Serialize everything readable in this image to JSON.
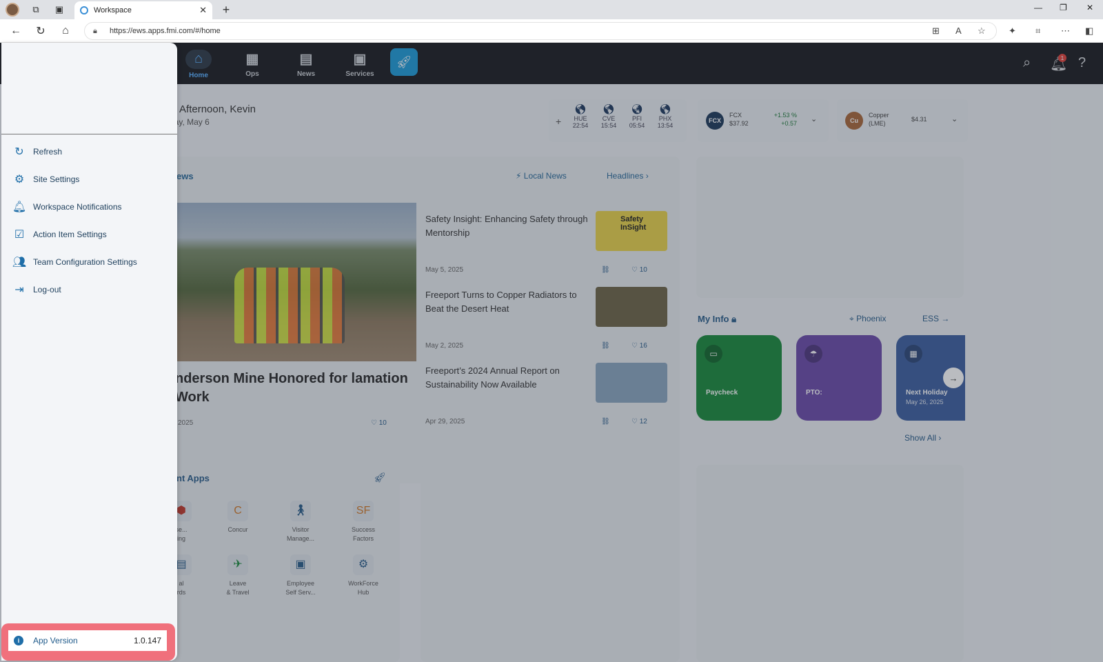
{
  "browser": {
    "tab_title": "Workspace",
    "url": "https://ews.apps.fmi.com/#/home"
  },
  "nav": {
    "items": [
      {
        "label": "Home",
        "icon": "home-icon"
      },
      {
        "label": "Ops",
        "icon": "grid-icon"
      },
      {
        "label": "News",
        "icon": "newspaper-icon"
      },
      {
        "label": "Services",
        "icon": "badge-icon"
      }
    ],
    "notification_count": "1"
  },
  "greeting": {
    "title": "od Afternoon, Kevin",
    "date": "sday, May 6"
  },
  "clocks": [
    {
      "code": "HUE",
      "time": "22:54"
    },
    {
      "code": "CVE",
      "time": "15:54"
    },
    {
      "code": "PFI",
      "time": "05:54"
    },
    {
      "code": "PHX",
      "time": "13:54"
    }
  ],
  "stock_fcx": {
    "logo": "FCX",
    "ticker": "FCX",
    "price": "$37.92",
    "pct": "+1.53 %",
    "change": "+0.57"
  },
  "stock_copper": {
    "logo": "Cu",
    "name": "Copper",
    "market": "(LME)",
    "price": "$4.31"
  },
  "news": {
    "heading": "ews",
    "local_news": "Local News",
    "headlines": "Headlines",
    "featured": {
      "title": "nderson Mine Honored for lamation Work",
      "date": "2025",
      "likes": "10"
    },
    "items": [
      {
        "title": "Safety Insight: Enhancing Safety through Mentorship",
        "date": "May 5, 2025",
        "likes": "10",
        "thumb_text": "Safety InSight"
      },
      {
        "title": "Freeport Turns to Copper Radiators to Beat the Desert Heat",
        "date": "May 2, 2025",
        "likes": "16"
      },
      {
        "title": "Freeport’s 2024 Annual Report on Sustainability Now Available",
        "date": "Apr 29, 2025",
        "likes": "12"
      }
    ]
  },
  "my_info": {
    "title": "My Info",
    "location": "Phoenix",
    "ess": "ESS",
    "tiles": [
      {
        "label": "Paycheck",
        "color": "#1a8a3c"
      },
      {
        "label": "PTO:",
        "color": "#6a4aa8"
      },
      {
        "label": "Next Holiday",
        "sub": "May 26, 2025",
        "color": "#3d5fa0"
      }
    ],
    "show_all": "Show All"
  },
  "apps": {
    "heading": "nt Apps",
    "items": [
      {
        "label": "se...\ning"
      },
      {
        "label": "Concur"
      },
      {
        "label": "Visitor\nManage..."
      },
      {
        "label": "Success\nFactors"
      },
      {
        "label": "al\nrds"
      },
      {
        "label": "Leave\n& Travel"
      },
      {
        "label": "Employee\nSelf Serv..."
      },
      {
        "label": "WorkForce\nHub"
      }
    ]
  },
  "drawer": {
    "menu": [
      {
        "label": "Refresh",
        "icon": "refresh-icon"
      },
      {
        "label": "Site Settings",
        "icon": "gear-icon"
      },
      {
        "label": "Workspace Notifications",
        "icon": "bell-icon"
      },
      {
        "label": "Action Item Settings",
        "icon": "calendar-check-icon"
      },
      {
        "label": "Team Configuration Settings",
        "icon": "users-icon"
      },
      {
        "label": "Log-out",
        "icon": "logout-icon"
      }
    ],
    "version_label": "App Version",
    "version_value": "1.0.147"
  }
}
